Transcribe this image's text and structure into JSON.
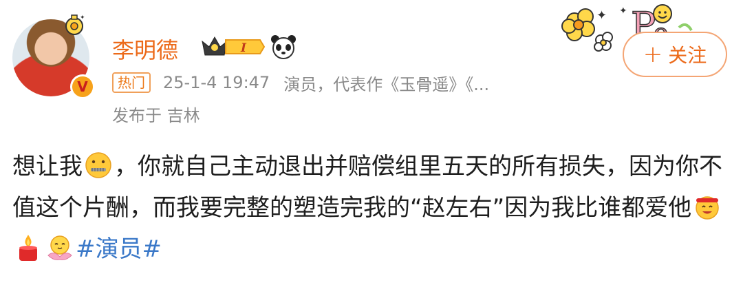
{
  "post": {
    "author": "李明德",
    "tag": "热门",
    "timestamp": "25-1-4 19:47",
    "source": "演员，代表作《玉骨遥》《...",
    "location": "发布于 吉林",
    "follow_label": "关注",
    "follow_icon": "+",
    "verified_badge": "V",
    "vip_level": "I",
    "body": {
      "part1": "想让我",
      "part2": "，你就自己主动退出并赔偿组里五天的所有损失，因为你不值这个片酬，而我要完整的塑造完我的“赵左右”因为我比谁都爱他",
      "hashtag": "#演员#"
    }
  },
  "colors": {
    "name": "#ec6a1a",
    "hashtag": "#3a78c8",
    "meta": "#8a8a8a"
  },
  "icons": [
    "avatar-frame-icon",
    "verified-icon",
    "vip-crown-icon",
    "panda-icon",
    "zipper-mouth-emoji",
    "party-emoji",
    "candle-emoji",
    "lotus-emoji",
    "decoration-flowers-icon",
    "plus-icon"
  ]
}
